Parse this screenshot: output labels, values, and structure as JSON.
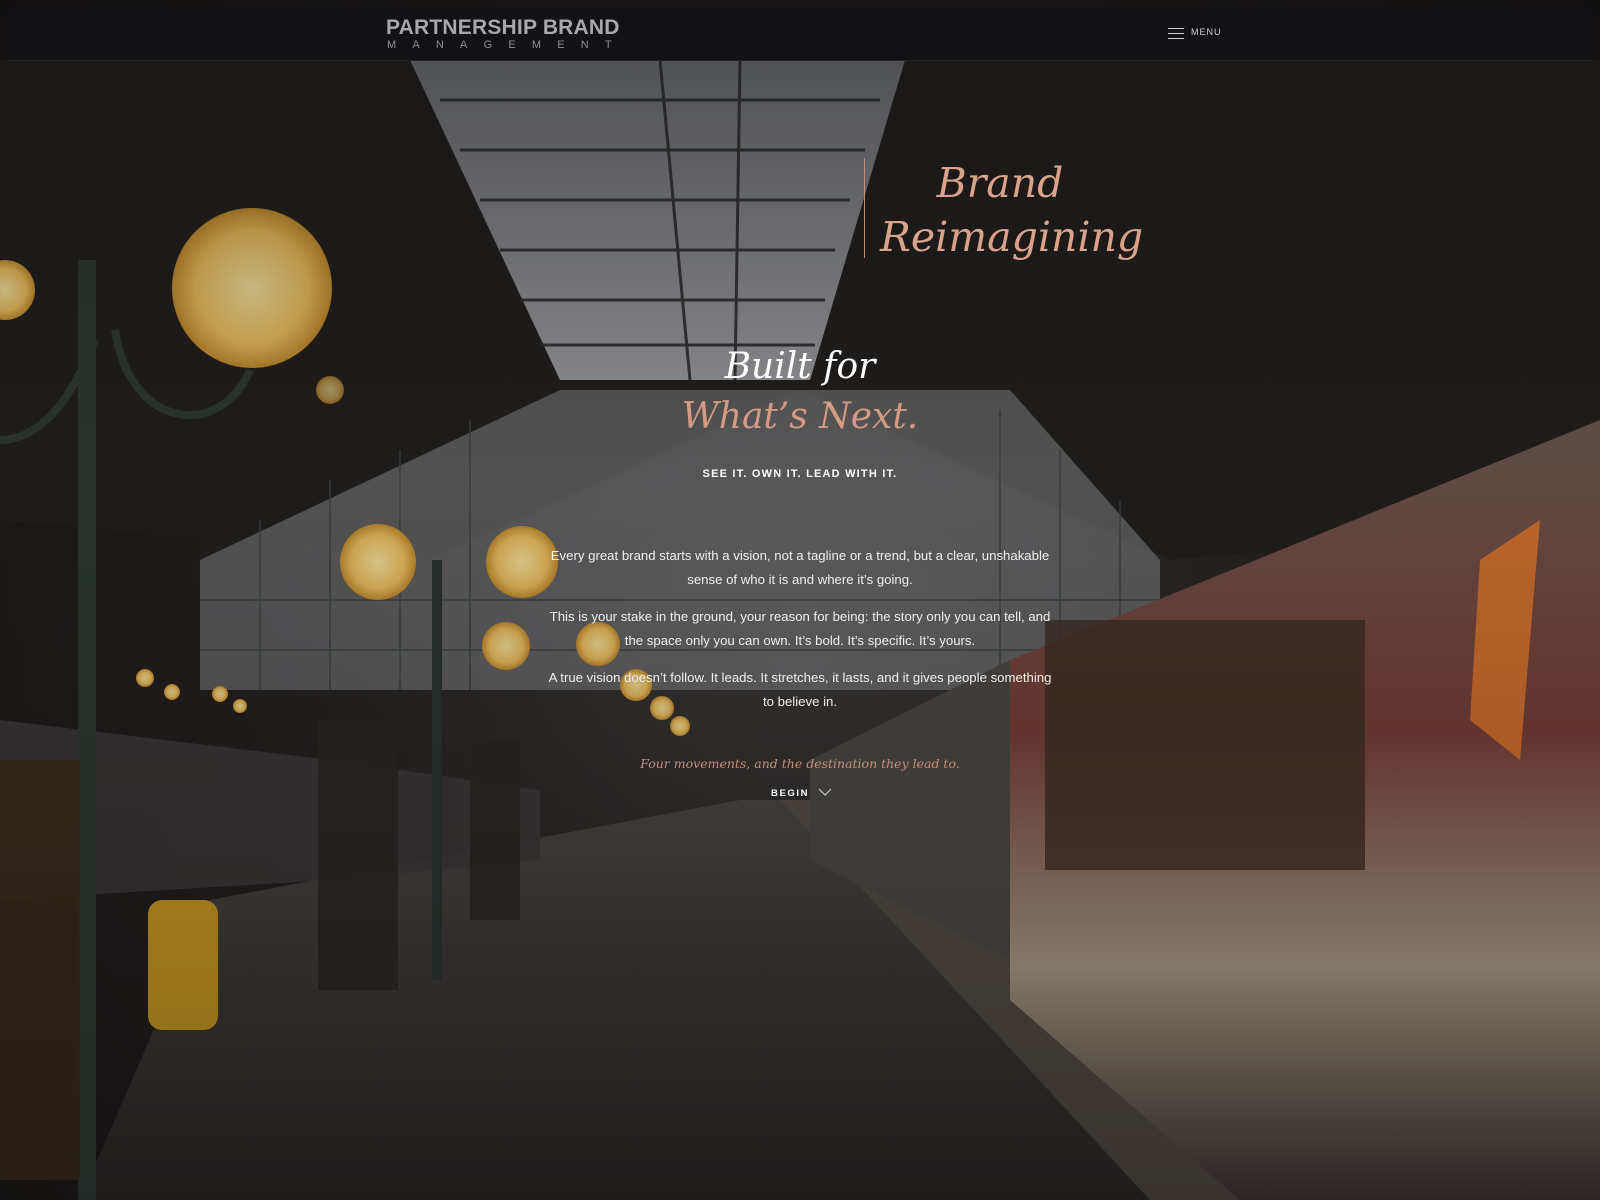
{
  "header": {
    "logo_main": "PARTNERSHIP BRAND",
    "logo_sub": "MANAGEMENT",
    "menu_label": "MENU",
    "menu_icon": "hamburger-icon"
  },
  "hero": {
    "tagline_line1": "Brand",
    "tagline_line2": "Reimagining",
    "headline_line1": "Built for",
    "headline_line2": "What’s Next.",
    "kicker": "SEE IT. OWN IT. LEAD WITH IT.",
    "paragraphs": [
      "Every great brand starts with a vision, not a tagline or a trend, but a clear, unshakable sense of who it is and where it’s going.",
      "This is your stake in the ground, your reason for being: the story only you can tell, and the space only you can own. It’s bold. It’s specific. It’s yours.",
      "A true vision doesn’t follow. It leads. It stretches, it lasts, and it gives people something to believe in."
    ],
    "closing": "Four movements, and the destination they lead to.",
    "begin_label": "BEGIN",
    "begin_icon": "chevron-down-icon"
  },
  "colors": {
    "header_bg": "#121215",
    "accent_copper": "#d8a38a",
    "text_white": "#ffffff"
  }
}
